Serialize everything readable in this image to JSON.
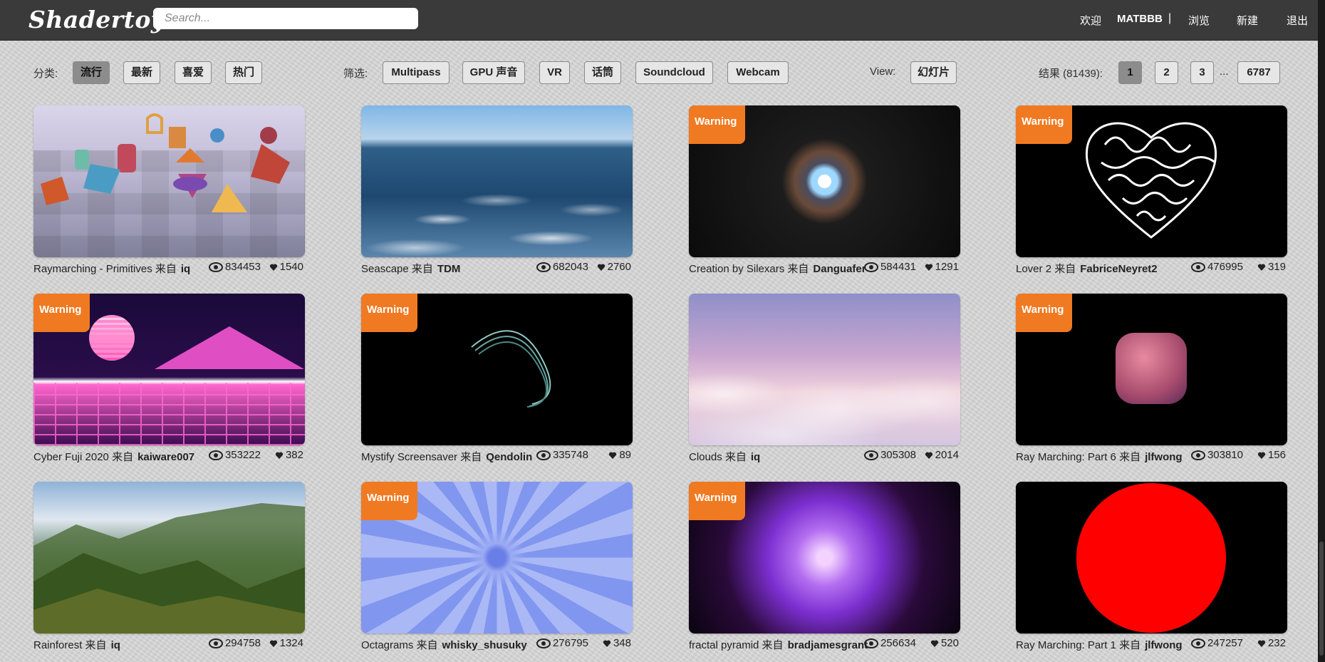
{
  "header": {
    "logo": "Shadertoy",
    "search_placeholder": "Search...",
    "welcome": "欢迎",
    "user": "MATBBB",
    "separator": "|",
    "browse": "浏览",
    "new": "新建",
    "logout": "退出"
  },
  "filters": {
    "category_label": "分类:",
    "categories": [
      {
        "label": "流行",
        "active": true
      },
      {
        "label": "最新",
        "active": false
      },
      {
        "label": "喜爱",
        "active": false
      },
      {
        "label": "热门",
        "active": false
      }
    ],
    "filter_label": "筛选:",
    "tags": [
      "Multipass",
      "GPU 声音",
      "VR",
      "话筒",
      "Soundcloud",
      "Webcam"
    ],
    "view_label": "View:",
    "view_value": "幻灯片",
    "results_label": "结果 (81439):",
    "pages": [
      "1",
      "2",
      "3"
    ],
    "current_page": "1",
    "ellipsis": "...",
    "last_page": "6787"
  },
  "shaders": [
    {
      "title": "Raymarching - Primitives",
      "by": "来自",
      "author": "iq",
      "views": "834453",
      "likes": "1540",
      "warning": false,
      "art": "primitives"
    },
    {
      "title": "Seascape",
      "by": "来自",
      "author": "TDM",
      "views": "682043",
      "likes": "2760",
      "warning": false,
      "art": "sea"
    },
    {
      "title": "Creation by Silexars",
      "by": "来自",
      "author": "Danguafer",
      "views": "584431",
      "likes": "1291",
      "warning": true,
      "art": "creation"
    },
    {
      "title": "Lover 2",
      "by": "来自",
      "author": "FabriceNeyret2",
      "views": "476995",
      "likes": "319",
      "warning": true,
      "art": "heart"
    },
    {
      "title": "Cyber Fuji 2020",
      "by": "来自",
      "author": "kaiware007",
      "views": "353222",
      "likes": "382",
      "warning": true,
      "art": "fuji"
    },
    {
      "title": "Mystify Screensaver",
      "by": "来自",
      "author": "Qendolin",
      "views": "335748",
      "likes": "89",
      "warning": true,
      "art": "mystify"
    },
    {
      "title": "Clouds",
      "by": "来自",
      "author": "iq",
      "views": "305308",
      "likes": "2014",
      "warning": false,
      "art": "clouds"
    },
    {
      "title": "Ray Marching: Part 6",
      "by": "来自",
      "author": "jlfwong",
      "views": "303810",
      "likes": "156",
      "warning": true,
      "art": "cube"
    },
    {
      "title": "Rainforest",
      "by": "来自",
      "author": "iq",
      "views": "294758",
      "likes": "1324",
      "warning": false,
      "art": "rainforest"
    },
    {
      "title": "Octagrams",
      "by": "来自",
      "author": "whisky_shusuky",
      "views": "276795",
      "likes": "348",
      "warning": true,
      "art": "octagrams"
    },
    {
      "title": "fractal pyramid",
      "by": "来自",
      "author": "bradjamesgrant",
      "views": "256634",
      "likes": "520",
      "warning": true,
      "art": "fractal"
    },
    {
      "title": "Ray Marching: Part 1",
      "by": "来自",
      "author": "jlfwong",
      "views": "247257",
      "likes": "232",
      "warning": false,
      "art": "red-disc"
    }
  ],
  "warning_label": "Warning",
  "icons": {
    "views": "eye-icon",
    "likes": "heart-icon"
  }
}
